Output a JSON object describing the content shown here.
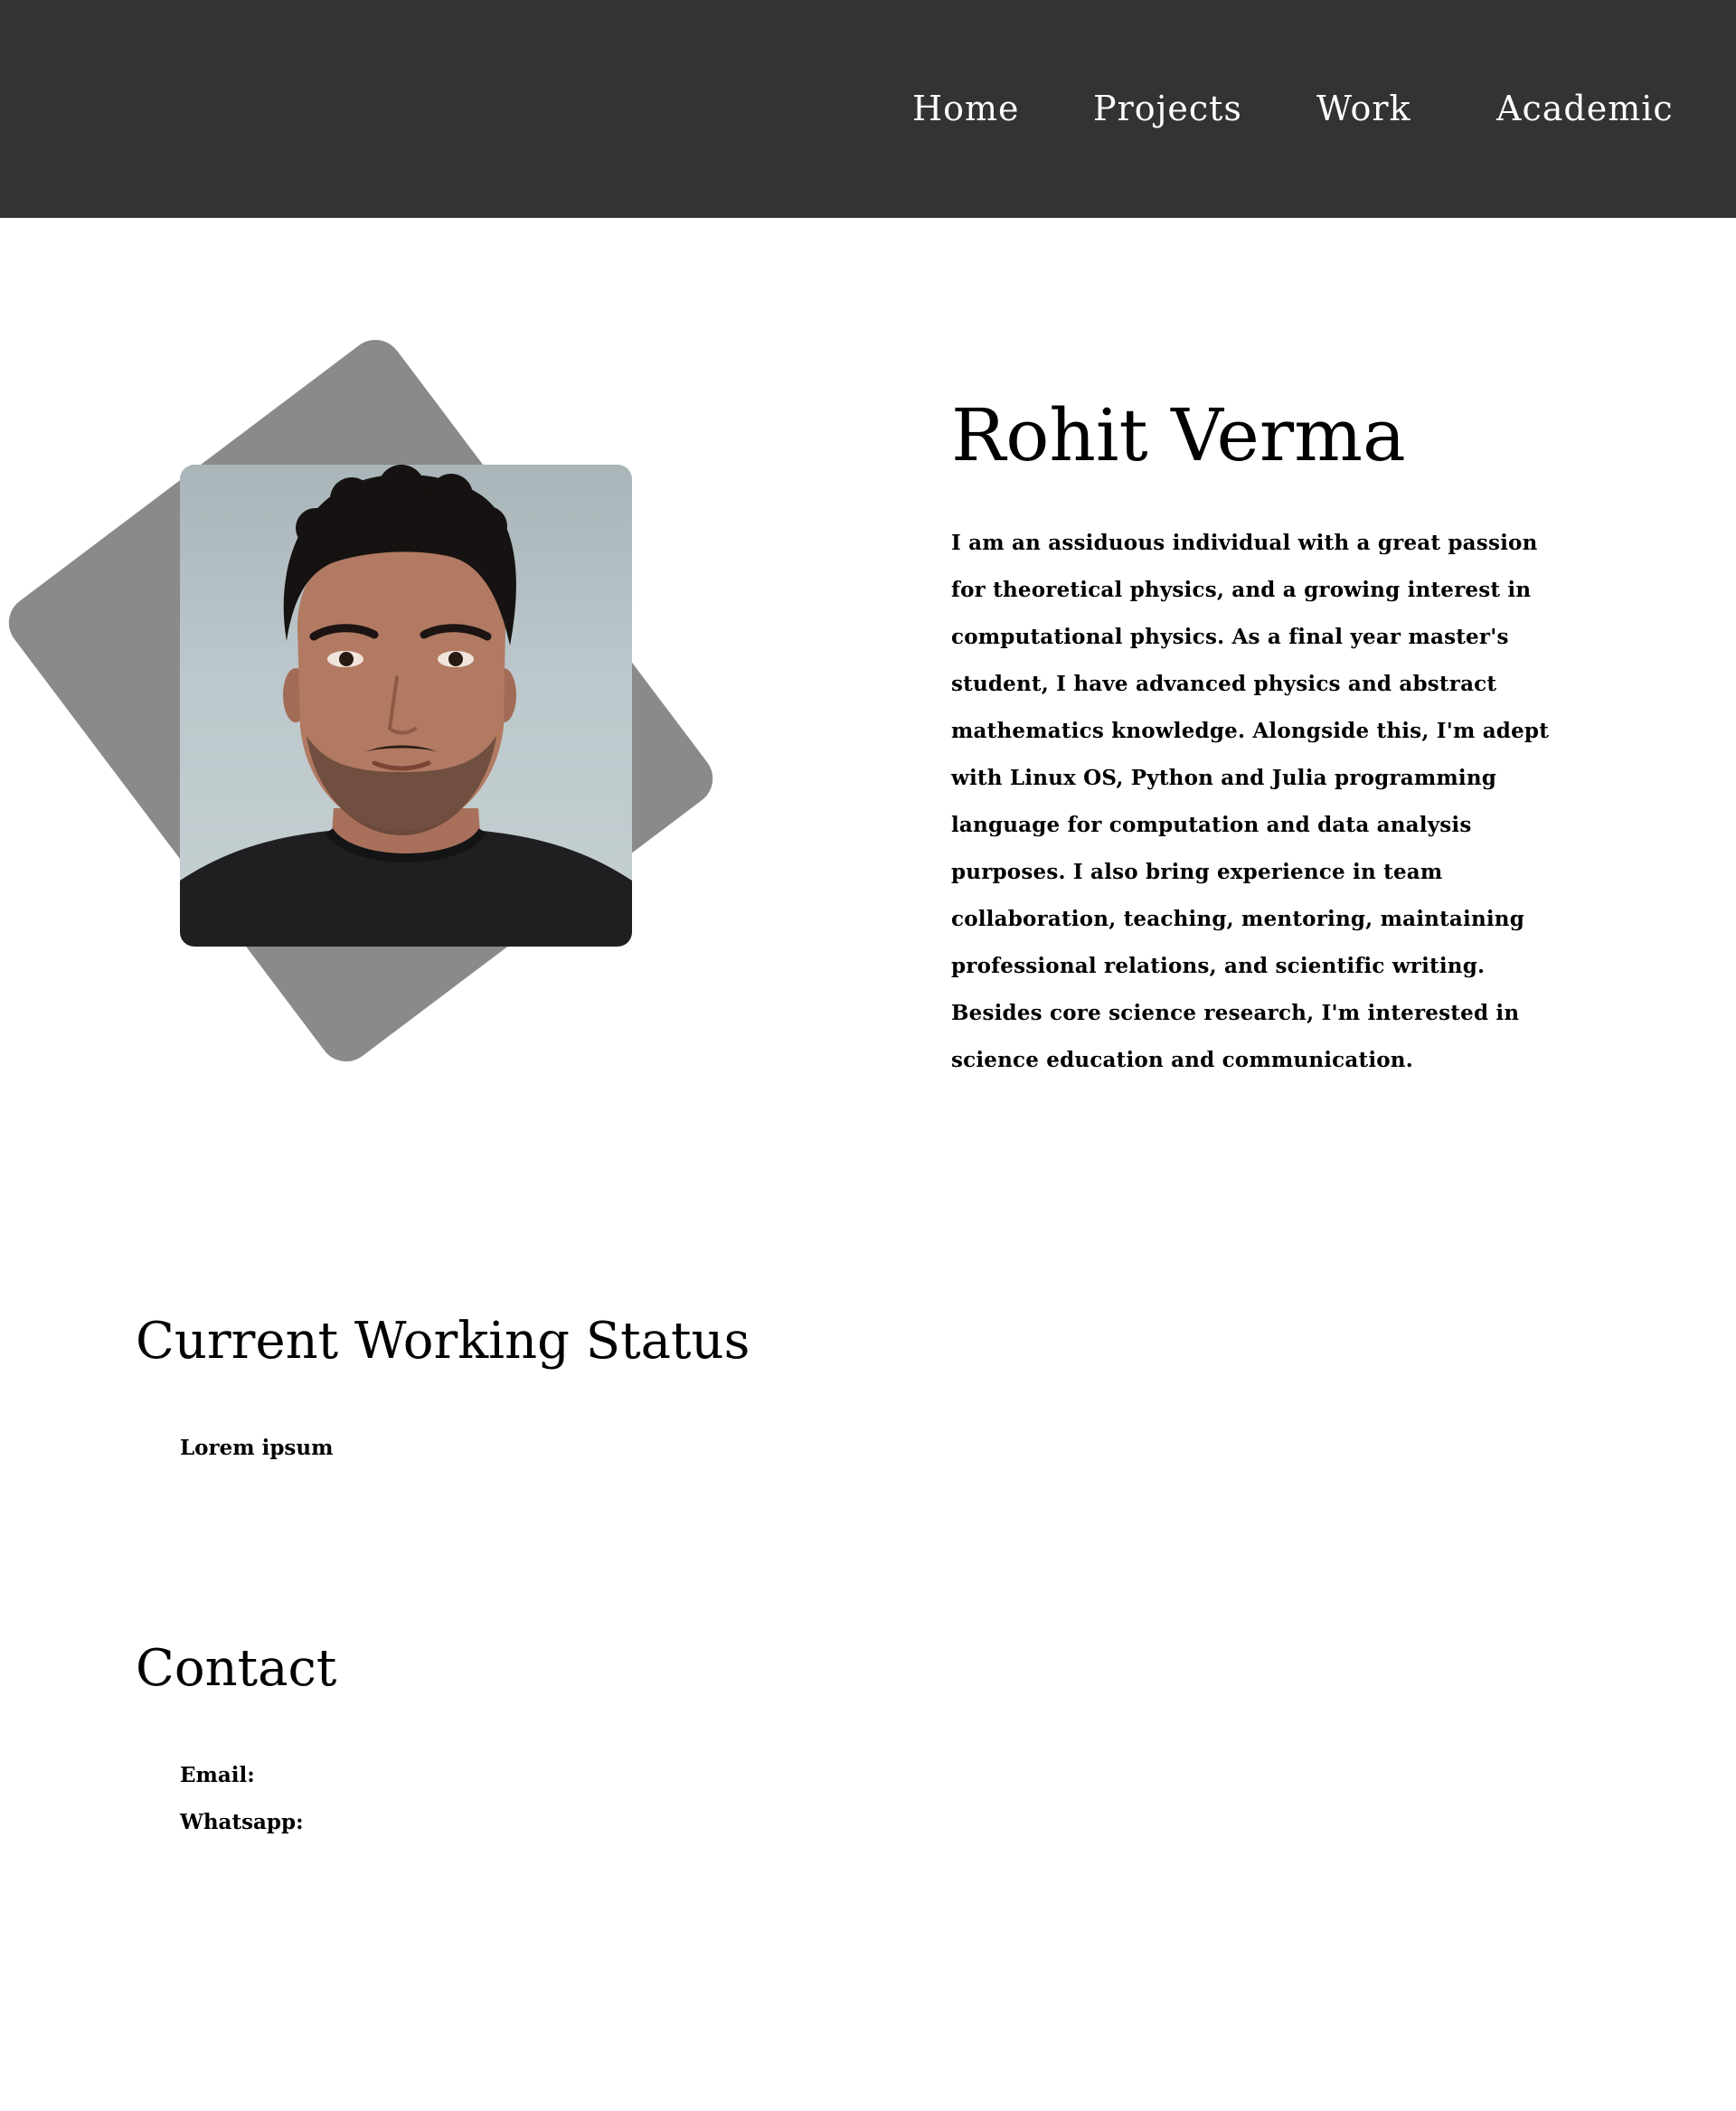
{
  "nav": {
    "items": [
      {
        "label": "Home"
      },
      {
        "label": "Projects"
      },
      {
        "label": "Work"
      },
      {
        "label": "Academic"
      }
    ]
  },
  "profile": {
    "name": "Rohit Verma",
    "bio": "I am an assiduous individual with a great passion for theoretical physics, and a growing interest in computational physics. As a final year master's student, I have advanced physics and abstract mathematics knowledge. Alongside this, I'm adept with Linux OS, Python and Julia programming language for computation and data analysis purposes. I also bring experience in team collaboration, teaching, mentoring, maintaining professional relations, and scientific writing. Besides core science research, I'm interested in science education and communication."
  },
  "status": {
    "title": "Current Working Status",
    "text": "Lorem ipsum"
  },
  "contact": {
    "title": "Contact",
    "email_label": "Email:",
    "whatsapp_label": "Whatsapp:"
  },
  "colors": {
    "navbar_bg": "#333333",
    "nav_text": "#ffffff",
    "diamond": "#8a8a8a",
    "text": "#000000"
  }
}
